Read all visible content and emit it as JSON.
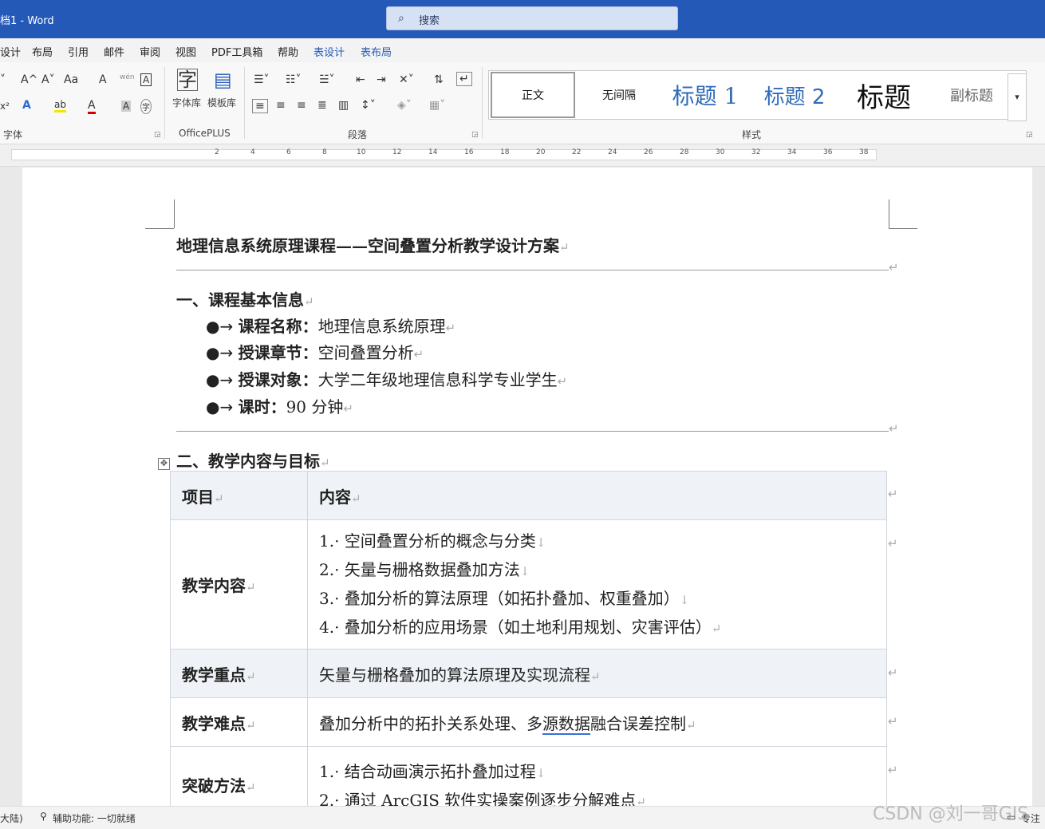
{
  "titlebar": {
    "title": "档1  -  Word",
    "search_icon": "search-icon",
    "search_placeholder": "搜索"
  },
  "menu": [
    {
      "label": "设计",
      "accent": false
    },
    {
      "label": "布局",
      "accent": false
    },
    {
      "label": "引用",
      "accent": false
    },
    {
      "label": "邮件",
      "accent": false
    },
    {
      "label": "审阅",
      "accent": false
    },
    {
      "label": "视图",
      "accent": false
    },
    {
      "label": "PDF工具箱",
      "accent": false
    },
    {
      "label": "帮助",
      "accent": false
    },
    {
      "label": "表设计",
      "accent": true
    },
    {
      "label": "表布局",
      "accent": true
    }
  ],
  "ribbon": {
    "font_group": "字体",
    "font_buttons": {
      "grow": "A^",
      "shrink": "A˅",
      "case": "Aa",
      "clear": "A",
      "phonetic": "wén",
      "border": "A",
      "super": "x²",
      "effect": "A",
      "highlight": "ab",
      "color": "A",
      "shade": "A",
      "enclose": "字"
    },
    "officeplus": {
      "fontlib": "字体库",
      "templates": "模板库",
      "group": "OfficePLUS"
    },
    "paragraph_group": "段落",
    "styles_group": "样式",
    "styles": [
      "正文",
      "无间隔",
      "标题 1",
      "标题 2",
      "标题",
      "副标题"
    ],
    "more": "▾"
  },
  "ruler": [
    "2",
    "4",
    "6",
    "8",
    "10",
    "12",
    "14",
    "16",
    "18",
    "20",
    "22",
    "24",
    "26",
    "28",
    "30",
    "32",
    "34",
    "36",
    "38"
  ],
  "doc": {
    "title": "地理信息系统原理课程——空间叠置分析教学设计方案",
    "para_mark": "↵",
    "line_break": "↓",
    "section1": "一、课程基本信息",
    "bullet_prefix": "●→ ",
    "bullets": [
      {
        "key": "课程名称：",
        "value": "地理信息系统原理"
      },
      {
        "key": "授课章节：",
        "value": "空间叠置分析"
      },
      {
        "key": "授课对象：",
        "value": "大学二年级地理信息科学专业学生"
      },
      {
        "key": "课时：",
        "value": "90 分钟"
      }
    ],
    "section2": "二、教学内容与目标",
    "table": {
      "head": [
        "项目",
        "内容"
      ],
      "content_label": "教学内容",
      "content_lines": [
        "1.· 空间叠置分析的概念与分类",
        "2.· 矢量与栅格数据叠加方法",
        "3.· 叠加分析的算法原理（如拓扑叠加、权重叠加）",
        "4.· 叠加分析的应用场景（如土地利用规划、灾害评估）"
      ],
      "focus_label": "教学重点",
      "focus": "矢量与栅格叠加的算法原理及实现流程",
      "difficulty_label": "教学难点",
      "difficulty_pre": "叠加分析中的拓扑关系处理、多",
      "difficulty_under": "源数据",
      "difficulty_post": "融合误差控制",
      "method_label": "突破方法",
      "method_lines": [
        "1.· 结合动画演示拓扑叠加过程",
        "2.· 通过 ArcGIS 软件实操案例逐步分解难点"
      ]
    }
  },
  "status": {
    "lang": "大陆)",
    "accessibility": "辅助功能: 一切就绪",
    "focus": "专注"
  },
  "watermark": "CSDN @刘一哥GIS"
}
